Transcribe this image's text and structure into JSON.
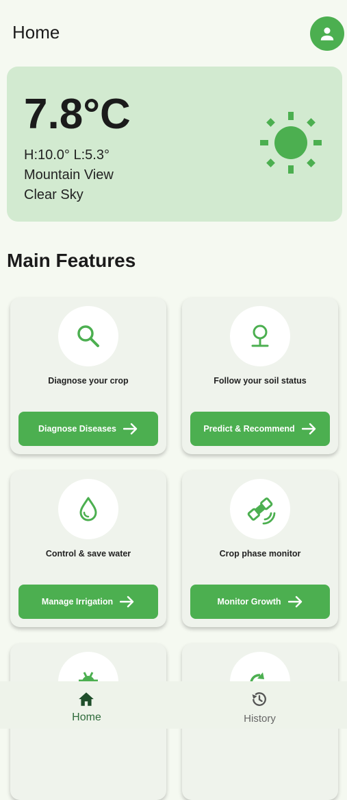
{
  "header": {
    "title": "Home"
  },
  "weather": {
    "temperature": "7.8°C",
    "high_low": "H:10.0° L:5.3°",
    "location": "Mountain View",
    "condition": "Clear Sky"
  },
  "section_title": "Main Features",
  "features": [
    {
      "description": "Diagnose your crop",
      "button": "Diagnose Diseases",
      "icon": "search-icon"
    },
    {
      "description": "Follow your soil status",
      "button": "Predict & Recommend",
      "icon": "plant-icon"
    },
    {
      "description": "Control & save water",
      "button": "Manage Irrigation",
      "icon": "water-drop-icon"
    },
    {
      "description": "Crop phase monitor",
      "button": "Monitor Growth",
      "icon": "satellite-icon"
    }
  ],
  "partial_features": [
    {
      "icon": "bug-icon"
    },
    {
      "icon": "refresh-icon"
    }
  ],
  "nav": {
    "home": "Home",
    "history": "History"
  },
  "colors": {
    "accent": "#4caf50",
    "background": "#f5f9f1",
    "weather_card": "#d2ead0",
    "card": "#eff3ec"
  }
}
